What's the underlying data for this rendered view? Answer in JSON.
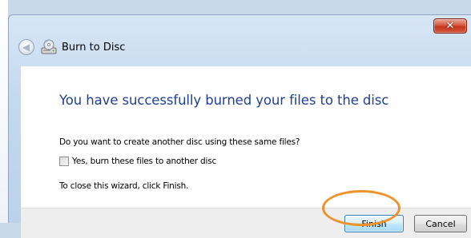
{
  "window": {
    "title": "Burn to Disc",
    "close_glyph": "✕",
    "back_glyph": "◀"
  },
  "icons": [
    "back-arrow-icon",
    "burn-disc-icon",
    "close-icon"
  ],
  "content": {
    "heading": "You have successfully burned your files to the disc",
    "question": "Do you want to create another disc using these same files?",
    "checkbox_label": "Yes, burn these files to another disc",
    "checkbox_checked": false,
    "close_hint": "To close this wizard, click Finish."
  },
  "buttons": {
    "finish": "Finish",
    "cancel": "Cancel"
  },
  "colors": {
    "heading": "#1f3f96",
    "highlight": "#f0922b",
    "close_button": "#c3361f"
  }
}
